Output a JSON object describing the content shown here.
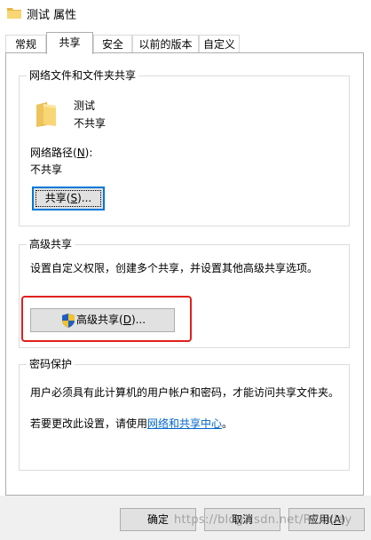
{
  "window": {
    "title": "测试 属性"
  },
  "tabs": [
    {
      "label": "常规"
    },
    {
      "label": "共享",
      "active": true
    },
    {
      "label": "安全"
    },
    {
      "label": "以前的版本"
    },
    {
      "label": "自定义"
    }
  ],
  "network_sharing": {
    "group_title": "网络文件和文件夹共享",
    "folder_name": "测试",
    "folder_status": "不共享",
    "path_label_pre": "网络路径(",
    "path_label_key": "N",
    "path_label_post": "):",
    "path_value": "不共享",
    "share_button": {
      "pre": "共享(",
      "key": "S",
      "post": ")..."
    }
  },
  "advanced_sharing": {
    "group_title": "高级共享",
    "description": "设置自定义权限，创建多个共享，并设置其他高级共享选项。",
    "button": {
      "pre": "高级共享(",
      "key": "D",
      "post": ")..."
    }
  },
  "password_protection": {
    "group_title": "密码保护",
    "description": "用户必须具有此计算机的用户帐户和密码，才能访问共享文件夹。",
    "change_pre": "若要更改此设置，请使用",
    "change_link": "网络和共享中心",
    "change_post": "。"
  },
  "footer": {
    "ok_label": "确定",
    "cancel_label": "取消",
    "apply_pre": "应用(",
    "apply_key": "A",
    "apply_post": ")"
  },
  "watermark": "https://blog.csdn.net/RECclay",
  "colors": {
    "highlight_box": "#e0211d",
    "link": "#0066cc",
    "focus": "#0078d7",
    "folder": "#f8d675"
  },
  "icons": {
    "title": "folder-icon",
    "folder": "folder-icon",
    "uac": "shield-icon"
  }
}
